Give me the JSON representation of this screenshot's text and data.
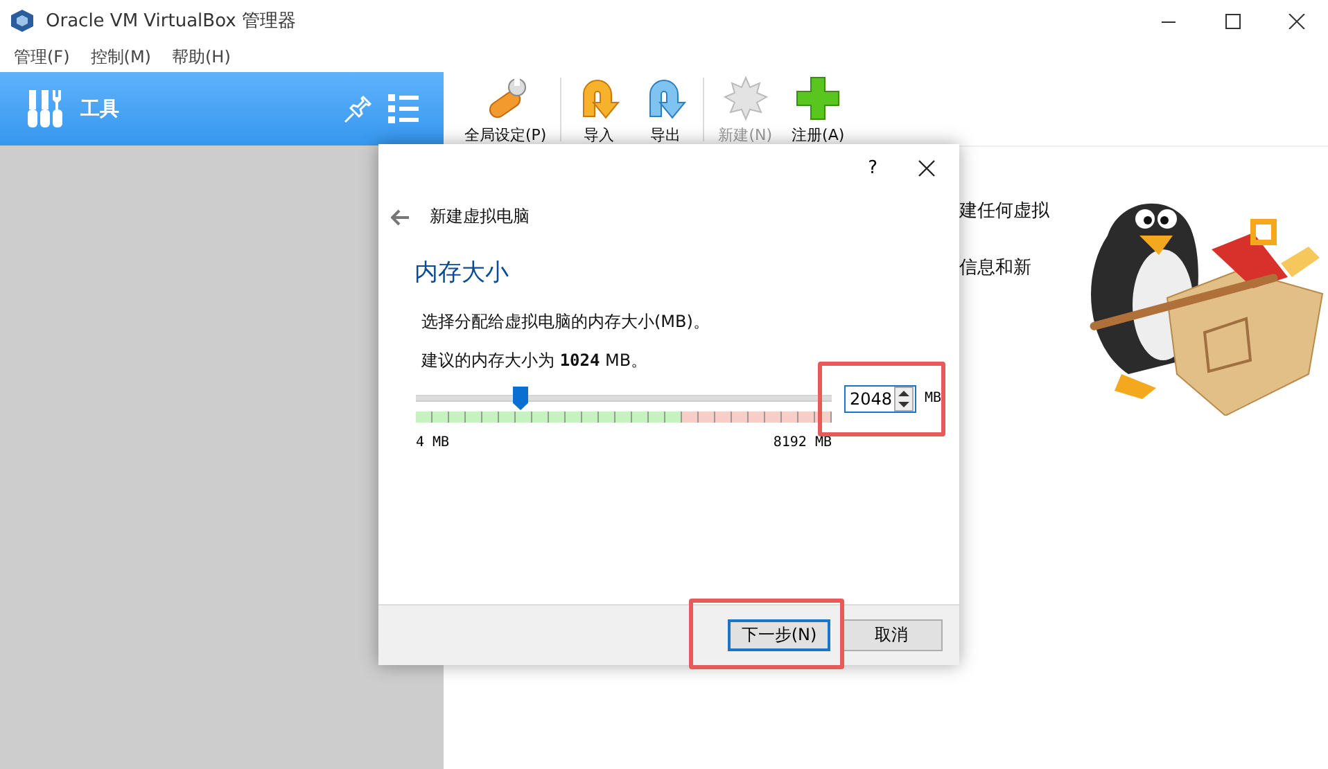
{
  "window": {
    "title": "Oracle VM VirtualBox 管理器"
  },
  "menu": [
    "管理(F)",
    "控制(M)",
    "帮助(H)"
  ],
  "sidebar": {
    "header": "工具",
    "selected": true
  },
  "toolbar": [
    {
      "label": "全局设定(P)",
      "kind": "settings",
      "disabled": false
    },
    {
      "label": "导入",
      "kind": "import",
      "disabled": false
    },
    {
      "label": "导出",
      "kind": "export",
      "disabled": false
    },
    {
      "label": "新建(N)",
      "kind": "new",
      "disabled": true
    },
    {
      "label": "注册(A)",
      "kind": "add",
      "disabled": false
    }
  ],
  "welcome_lines": [
    "建任何虚拟",
    "信息和新"
  ],
  "dialog": {
    "help": "?",
    "title": "新建虚拟电脑",
    "heading": "内存大小",
    "description": "选择分配给虚拟电脑的内存大小(MB)。",
    "recommendation": "建议的内存大小为 **1024** MB。",
    "memory": {
      "level": 0.25,
      "value": "2048",
      "unit": "MB",
      "min_label": "4 MB",
      "max_label": "8192 MB",
      "highlighted": true
    },
    "buttons": [
      {
        "label": "下一步(N)",
        "default": true,
        "highlighted": true
      },
      {
        "label": "取消",
        "default": false,
        "highlighted": false
      }
    ]
  }
}
